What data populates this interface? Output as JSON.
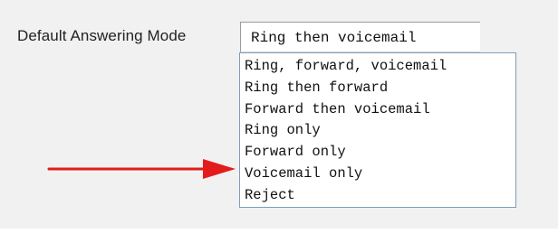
{
  "form": {
    "label": "Default Answering Mode",
    "selected_value": "Ring then voicemail",
    "options": [
      "Ring, forward, voicemail",
      "Ring then forward",
      "Forward then voicemail",
      "Ring only",
      "Forward only",
      "Voicemail only",
      "Reject"
    ]
  },
  "annotation": {
    "arrow_color": "#e31b1b",
    "icon": "arrow-right-icon"
  },
  "colors": {
    "panel_background": "#f1f1f1",
    "list_border": "#7f9db9"
  }
}
